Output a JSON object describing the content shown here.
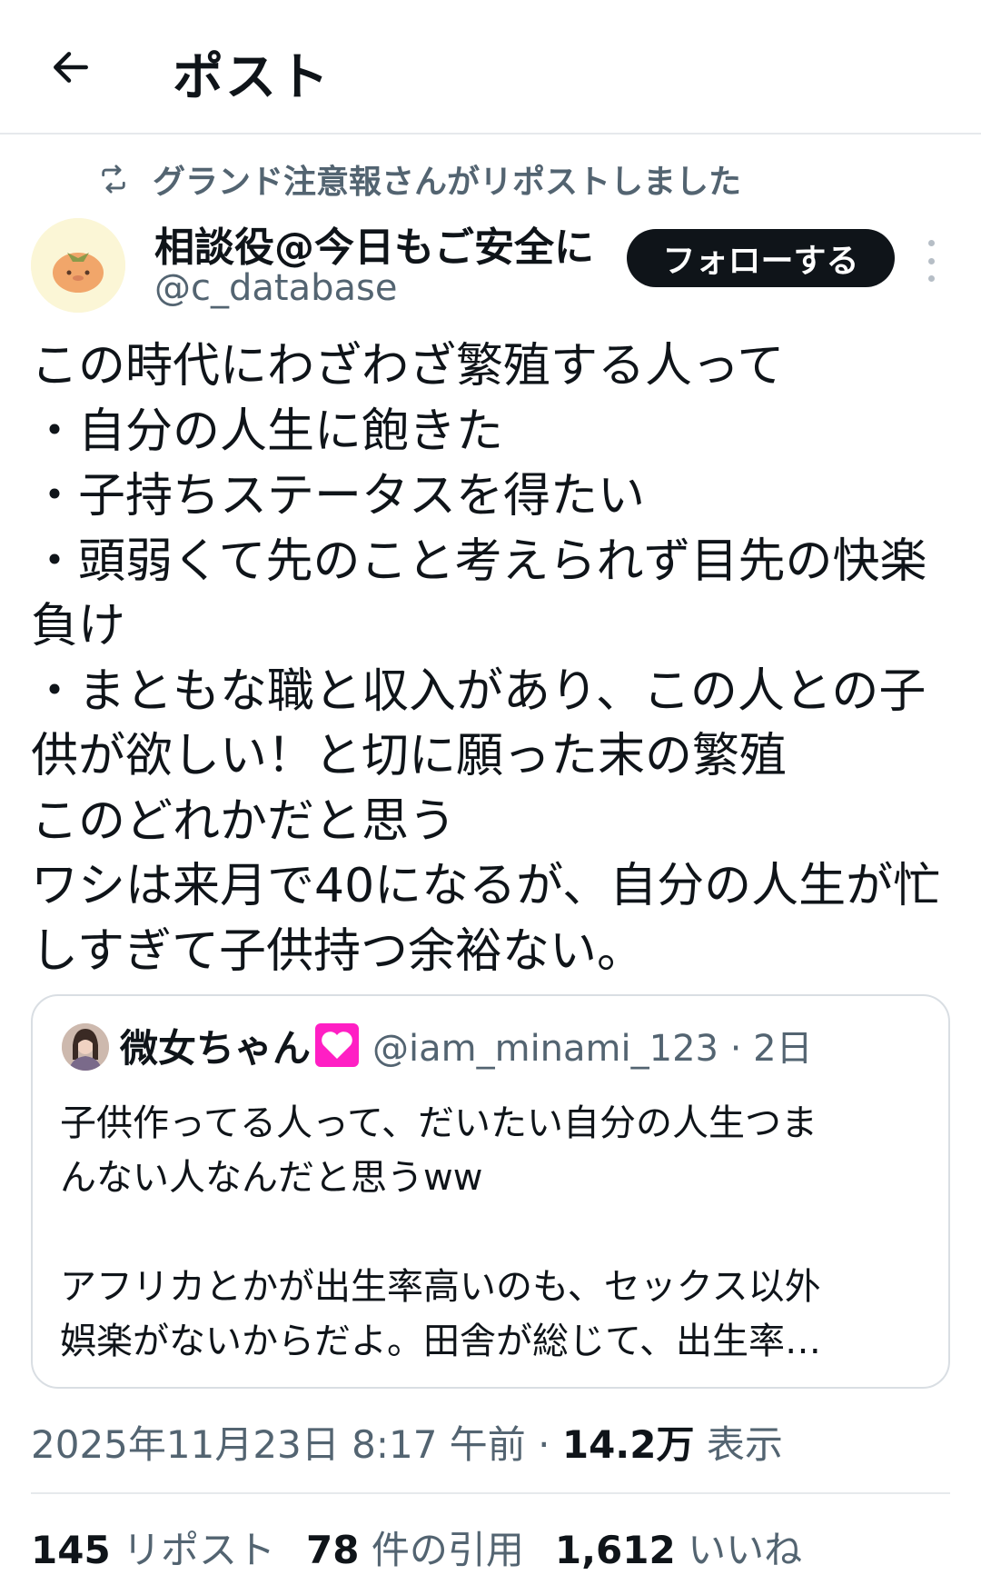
{
  "header": {
    "title": "ポスト",
    "back_icon": "arrow-left-icon"
  },
  "repost": {
    "text": "グランド注意報さんがリポストしました",
    "icon": "repost-icon"
  },
  "author": {
    "name": "相談役@今日もご安全に",
    "handle": "@c_database",
    "follow_label": "フォローする"
  },
  "post_lines": [
    "この時代にわざわざ繁殖する人って",
    "・自分の人生に飽きた",
    "・子持ちステータスを得たい",
    "・頭弱くて先のこと考えられず目先の快楽",
    "負け",
    "・まともな職と収入があり、この人との子",
    "供が欲しい！と切に願った末の繁殖",
    "このどれかだと思う",
    "ワシは来月で40になるが、自分の人生が忙",
    "しすぎて子供持つ余裕ない。"
  ],
  "quoted": {
    "name": "微女ちゃん",
    "handle_time": "@iam_minami_123 · 2日",
    "lines": [
      "子供作ってる人って、だいたい自分の人生つま",
      "んない人なんだと思うww",
      "",
      "アフリカとかが出生率高いのも、セックス以外",
      "娯楽がないからだよ。田舎が総じて、出生率…"
    ]
  },
  "meta": {
    "datetime": "2025年11月23日 8:17 午前 · ",
    "views": "14.2万",
    "views_label": " 表示"
  },
  "stats": [
    {
      "count": "145",
      "label": "リポスト"
    },
    {
      "count": "78",
      "label": "件の引用"
    },
    {
      "count": "1,612",
      "label": "いいね"
    }
  ],
  "colors": {
    "text": "#0f1419",
    "secondary": "#536471",
    "border": "#d9dee3",
    "button": "#0f1419",
    "heart": "#ff1fc4"
  }
}
